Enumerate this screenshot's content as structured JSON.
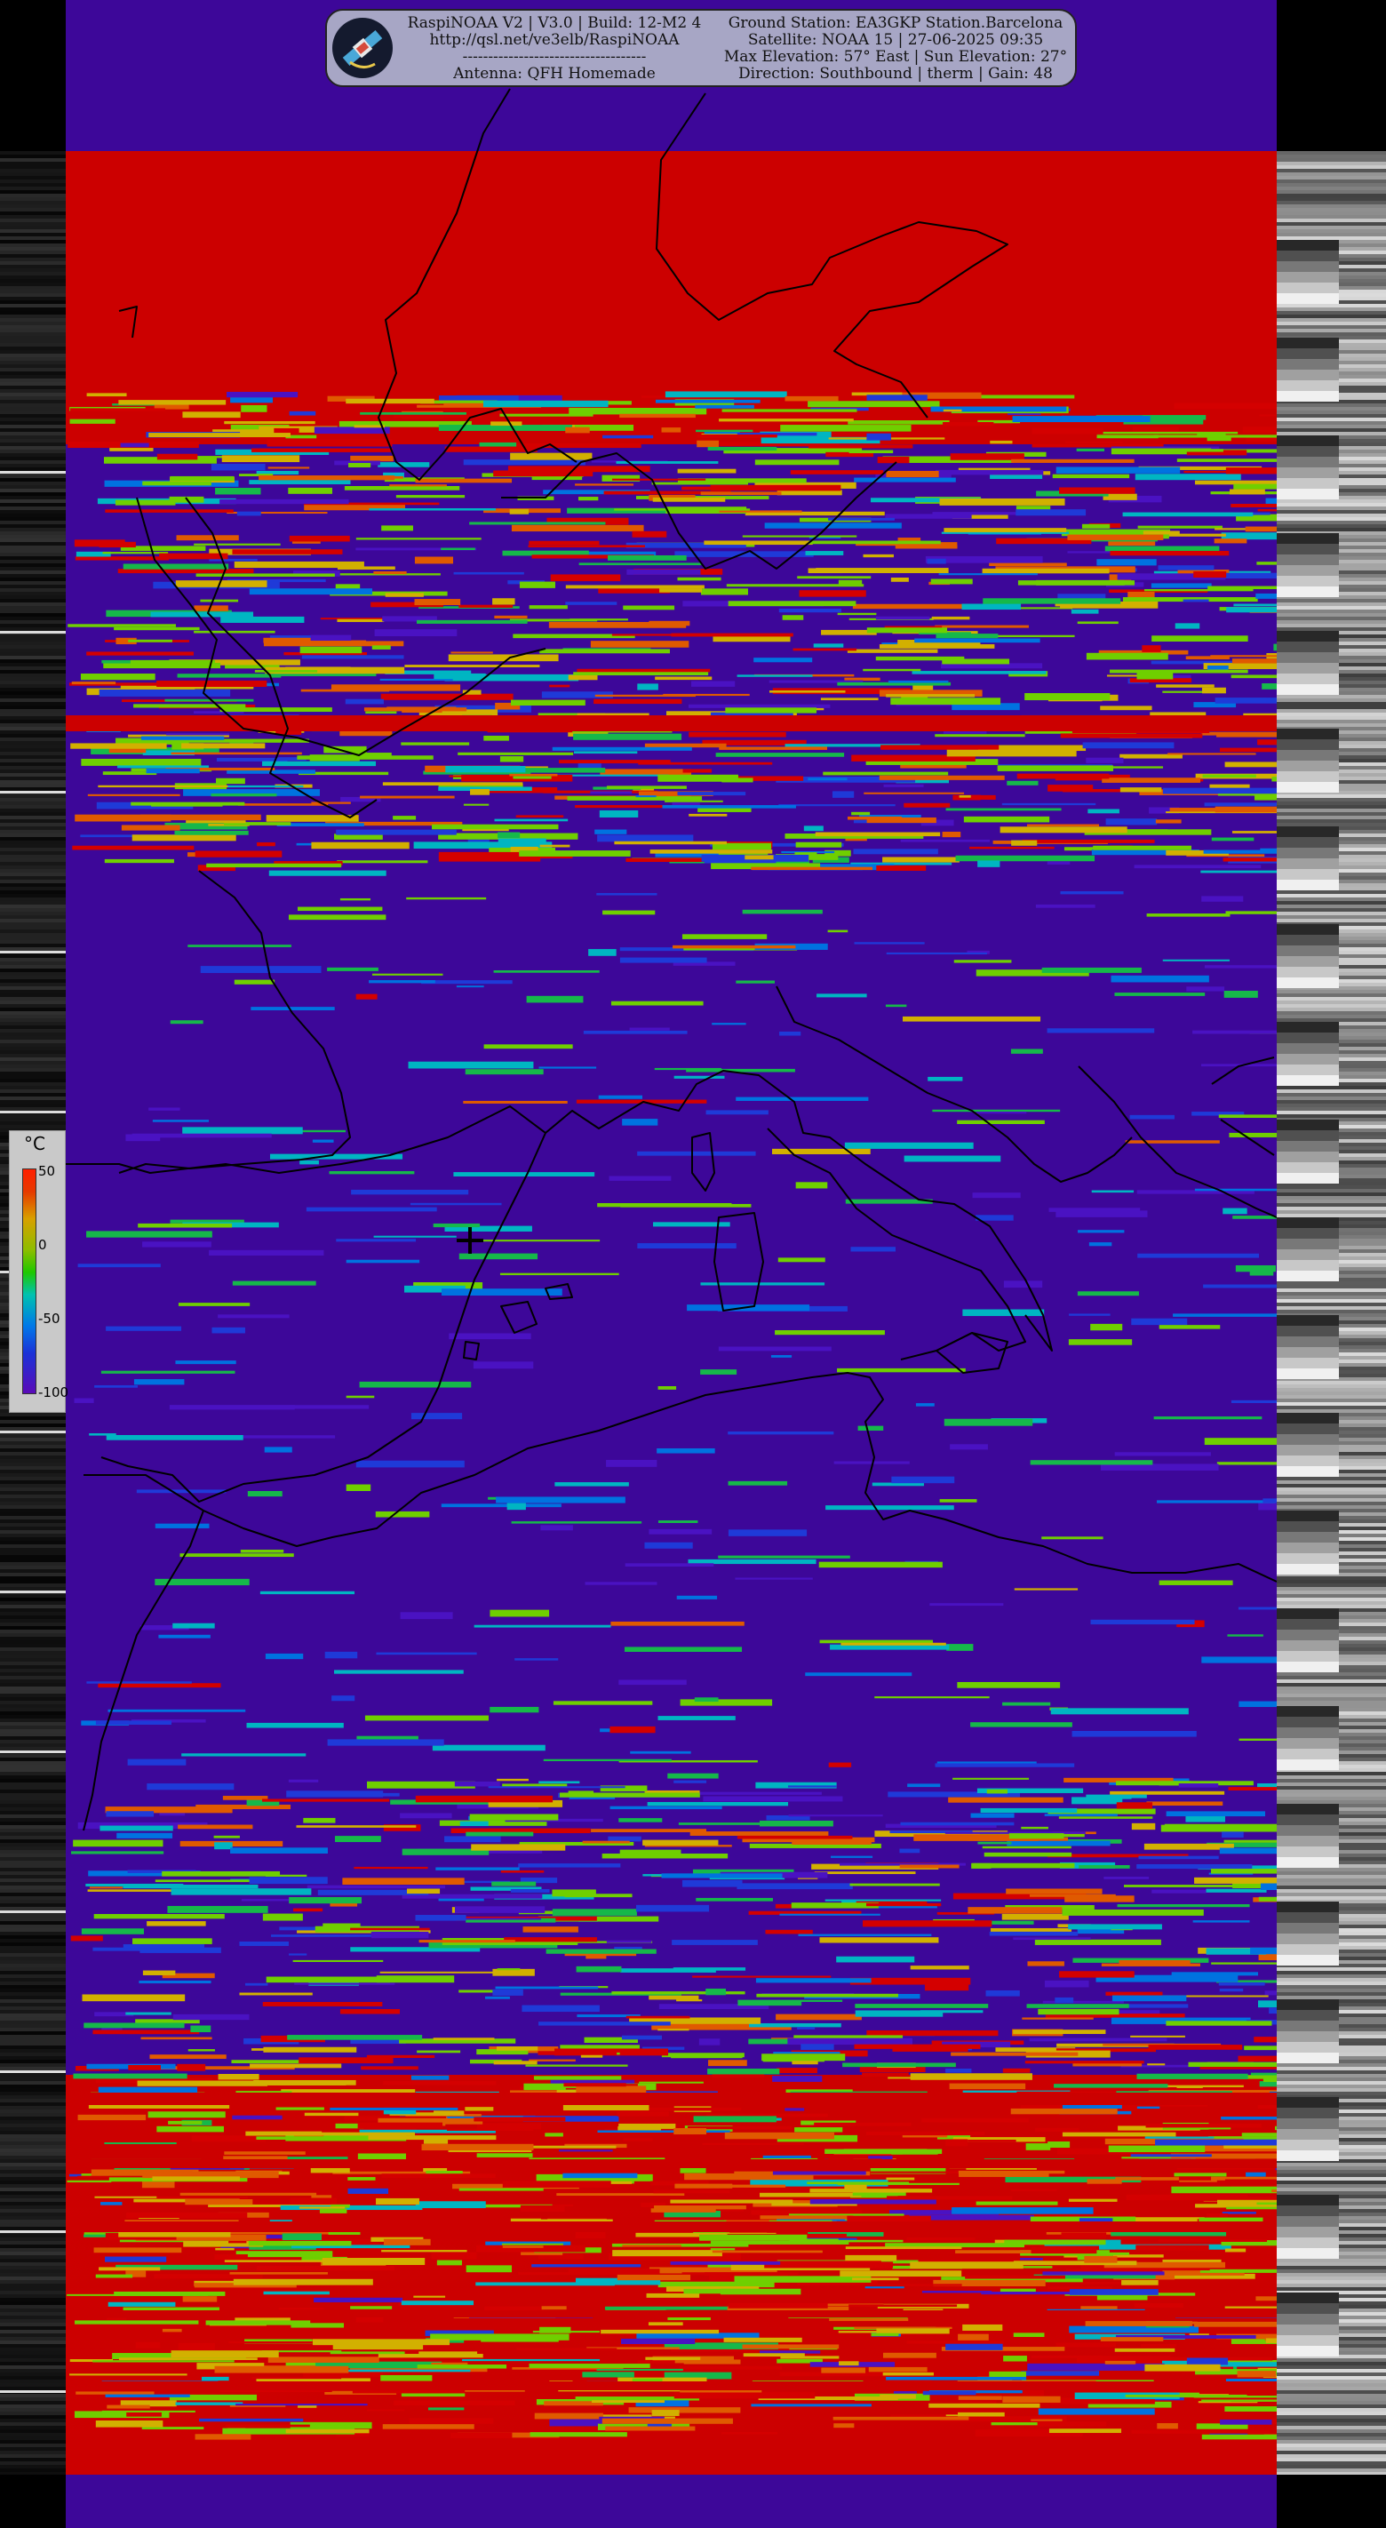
{
  "header": {
    "software_line": "RaspiNOAA V2 | V3.0 | Build: 12-M2 4",
    "website": "http://qsl.net/ve3elb/RaspiNOAA",
    "separator": "------------------------------------",
    "antenna": "Antenna: QFH Homemade",
    "ground_station": "Ground Station: EA3GKP Station.Barcelona",
    "satellite_time": "Satellite: NOAA 15 | 27-06-2025 09:35",
    "elevation": "Max Elevation: 57° East | Sun Elevation: 27°",
    "pass_details": "Direction: Southbound | therm | Gain: 48"
  },
  "legend": {
    "unit": "°C",
    "ticks": [
      {
        "label": "50",
        "value": 50
      },
      {
        "label": "0",
        "value": 0
      },
      {
        "label": "-50",
        "value": -50
      },
      {
        "label": "-100",
        "value": -100
      }
    ]
  },
  "colors": {
    "cold_background": "#3d0799",
    "warm_band": "#cc0000",
    "coastline": "#000000"
  },
  "icons": {
    "logo": "satellite-logo-icon",
    "ground_station_marker": "crosshair-icon"
  }
}
